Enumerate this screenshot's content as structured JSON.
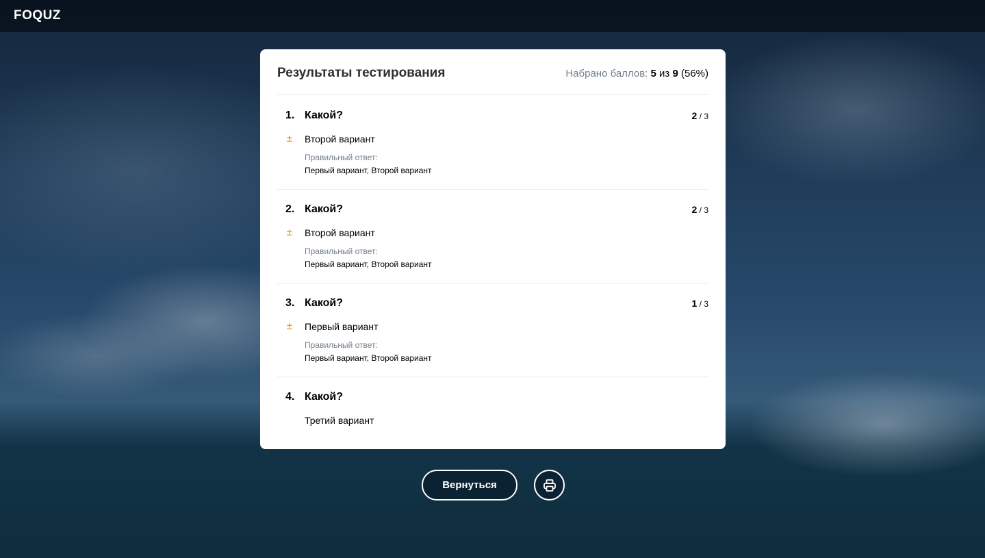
{
  "app": {
    "logo": "FOQUZ"
  },
  "results": {
    "title": "Результаты тестирования",
    "score_label": "Набрано баллов:",
    "score_value": "5",
    "score_of": "из",
    "score_max": "9",
    "score_percent": "(56%)"
  },
  "questions": [
    {
      "number": "1.",
      "text": "Какой?",
      "points": "2",
      "points_max": "/ 3",
      "status_icon": "±",
      "answer": "Второй вариант",
      "correct_label": "Правильный ответ:",
      "correct_value": "Первый вариант, Второй вариант"
    },
    {
      "number": "2.",
      "text": "Какой?",
      "points": "2",
      "points_max": "/ 3",
      "status_icon": "±",
      "answer": "Второй вариант",
      "correct_label": "Правильный ответ:",
      "correct_value": "Первый вариант, Второй вариант"
    },
    {
      "number": "3.",
      "text": "Какой?",
      "points": "1",
      "points_max": "/ 3",
      "status_icon": "±",
      "answer": "Первый вариант",
      "correct_label": "Правильный ответ:",
      "correct_value": "Первый вариант, Второй вариант"
    },
    {
      "number": "4.",
      "text": "Какой?",
      "answer": "Третий вариант"
    }
  ],
  "actions": {
    "back_label": "Вернуться",
    "print_icon": "printer-icon"
  },
  "colors": {
    "partial": "#f0a016",
    "muted": "#73808d",
    "card": "#ffffff"
  }
}
